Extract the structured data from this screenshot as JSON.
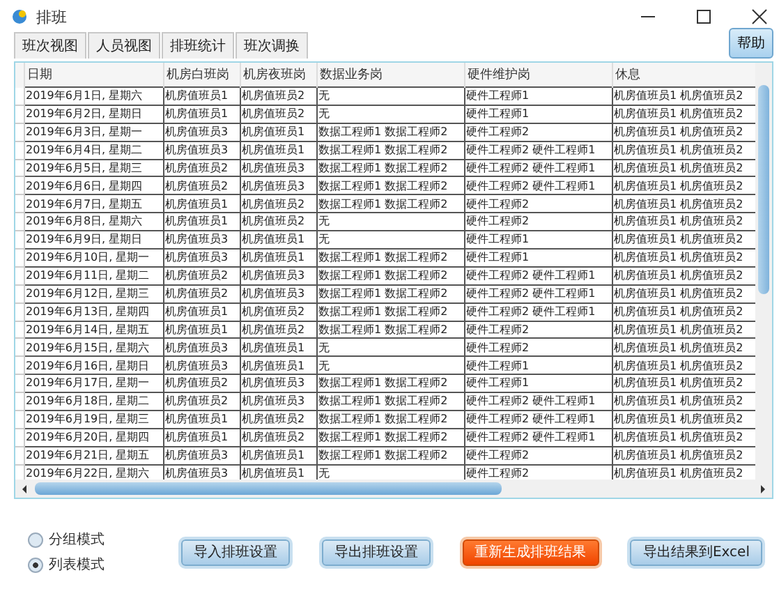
{
  "window": {
    "title": "排班"
  },
  "tabs": [
    {
      "label": "班次视图"
    },
    {
      "label": "人员视图"
    },
    {
      "label": "排班统计"
    },
    {
      "label": "班次调换"
    }
  ],
  "help_button": "帮助",
  "table": {
    "columns": [
      "日期",
      "机房白班岗",
      "机房夜班岗",
      "数据业务岗",
      "硬件维护岗",
      "休息"
    ],
    "rows": [
      [
        "2019年6月1日, 星期六",
        "机房值班员1",
        "机房值班员2",
        "无",
        "硬件工程师1",
        "机房值班员1 机房值班员2"
      ],
      [
        "2019年6月2日, 星期日",
        "机房值班员1",
        "机房值班员2",
        "无",
        "硬件工程师1",
        "机房值班员1 机房值班员2"
      ],
      [
        "2019年6月3日, 星期一",
        "机房值班员3",
        "机房值班员1",
        "数据工程师1  数据工程师2",
        "硬件工程师2",
        "机房值班员1 机房值班员2"
      ],
      [
        "2019年6月4日, 星期二",
        "机房值班员3",
        "机房值班员1",
        "数据工程师1  数据工程师2",
        "硬件工程师2  硬件工程师1",
        "机房值班员1 机房值班员2"
      ],
      [
        "2019年6月5日, 星期三",
        "机房值班员2",
        "机房值班员3",
        "数据工程师1  数据工程师2",
        "硬件工程师2  硬件工程师1",
        "机房值班员1 机房值班员2"
      ],
      [
        "2019年6月6日, 星期四",
        "机房值班员2",
        "机房值班员3",
        "数据工程师1  数据工程师2",
        "硬件工程师2  硬件工程师1",
        "机房值班员1 机房值班员2"
      ],
      [
        "2019年6月7日, 星期五",
        "机房值班员1",
        "机房值班员2",
        "数据工程师1  数据工程师2",
        "硬件工程师2",
        "机房值班员1 机房值班员2"
      ],
      [
        "2019年6月8日, 星期六",
        "机房值班员1",
        "机房值班员2",
        "无",
        "硬件工程师2",
        "机房值班员1 机房值班员2"
      ],
      [
        "2019年6月9日, 星期日",
        "机房值班员3",
        "机房值班员1",
        "无",
        "硬件工程师1",
        "机房值班员1 机房值班员2"
      ],
      [
        "2019年6月10日, 星期一",
        "机房值班员3",
        "机房值班员1",
        "数据工程师1  数据工程师2",
        "硬件工程师1",
        "机房值班员1 机房值班员2"
      ],
      [
        "2019年6月11日, 星期二",
        "机房值班员2",
        "机房值班员3",
        "数据工程师1  数据工程师2",
        "硬件工程师2  硬件工程师1",
        "机房值班员1 机房值班员2"
      ],
      [
        "2019年6月12日, 星期三",
        "机房值班员2",
        "机房值班员3",
        "数据工程师1  数据工程师2",
        "硬件工程师2  硬件工程师1",
        "机房值班员1 机房值班员2"
      ],
      [
        "2019年6月13日, 星期四",
        "机房值班员1",
        "机房值班员2",
        "数据工程师1  数据工程师2",
        "硬件工程师2  硬件工程师1",
        "机房值班员1 机房值班员2"
      ],
      [
        "2019年6月14日, 星期五",
        "机房值班员1",
        "机房值班员2",
        "数据工程师1  数据工程师2",
        "硬件工程师2",
        "机房值班员1 机房值班员2"
      ],
      [
        "2019年6月15日, 星期六",
        "机房值班员3",
        "机房值班员1",
        "无",
        "硬件工程师2",
        "机房值班员1 机房值班员2"
      ],
      [
        "2019年6月16日, 星期日",
        "机房值班员3",
        "机房值班员1",
        "无",
        "硬件工程师1",
        "机房值班员1 机房值班员2"
      ],
      [
        "2019年6月17日, 星期一",
        "机房值班员2",
        "机房值班员3",
        "数据工程师1  数据工程师2",
        "硬件工程师1",
        "机房值班员1 机房值班员2"
      ],
      [
        "2019年6月18日, 星期二",
        "机房值班员2",
        "机房值班员3",
        "数据工程师1  数据工程师2",
        "硬件工程师2  硬件工程师1",
        "机房值班员1 机房值班员2"
      ],
      [
        "2019年6月19日, 星期三",
        "机房值班员1",
        "机房值班员2",
        "数据工程师1  数据工程师2",
        "硬件工程师2  硬件工程师1",
        "机房值班员1 机房值班员2"
      ],
      [
        "2019年6月20日, 星期四",
        "机房值班员1",
        "机房值班员2",
        "数据工程师1  数据工程师2",
        "硬件工程师2  硬件工程师1",
        "机房值班员1 机房值班员2"
      ],
      [
        "2019年6月21日, 星期五",
        "机房值班员3",
        "机房值班员1",
        "数据工程师1  数据工程师2",
        "硬件工程师2",
        "机房值班员1 机房值班员2"
      ],
      [
        "2019年6月22日, 星期六",
        "机房值班员3",
        "机房值班员1",
        "无",
        "硬件工程师2",
        "机房值班员1 机房值班员2"
      ]
    ]
  },
  "modes": [
    {
      "label": "分组模式",
      "selected": false
    },
    {
      "label": "列表模式",
      "selected": true
    }
  ],
  "buttons": [
    {
      "label": "导入排班设置",
      "kind": "normal"
    },
    {
      "label": "导出排班设置",
      "kind": "normal"
    },
    {
      "label": "重新生成排班结果",
      "kind": "primary"
    },
    {
      "label": "导出结果到Excel",
      "kind": "normal"
    }
  ]
}
